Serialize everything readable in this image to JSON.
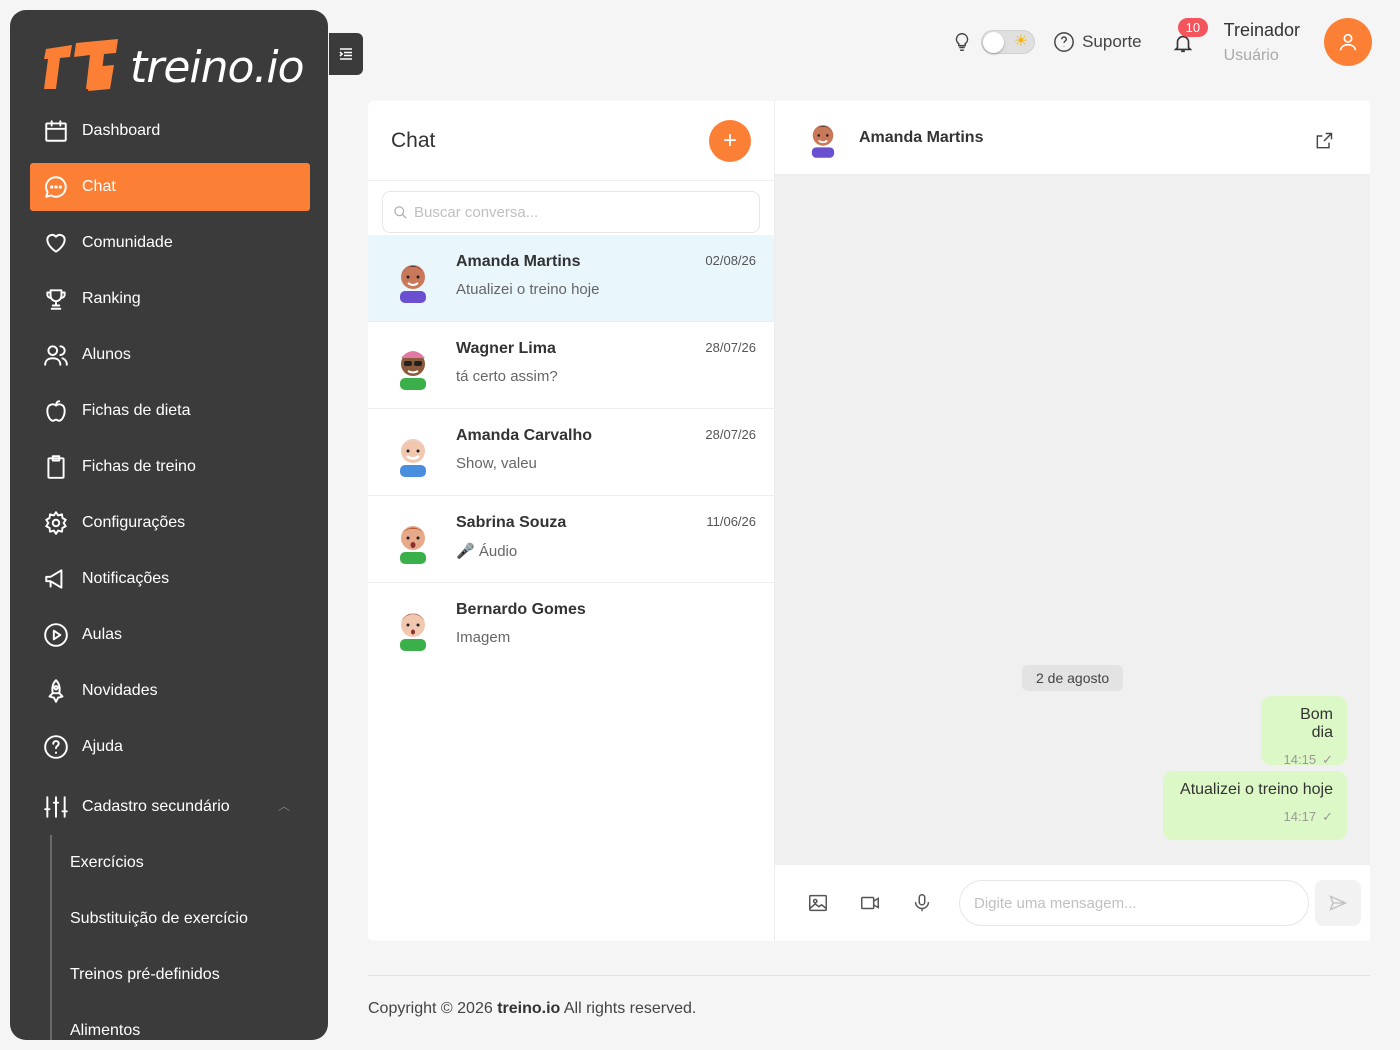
{
  "app": {
    "logo_text": "treino.io"
  },
  "sidebar": {
    "items": [
      {
        "label": "Dashboard",
        "icon": "calendar-icon"
      },
      {
        "label": "Chat",
        "icon": "chat-icon",
        "active": true
      },
      {
        "label": "Comunidade",
        "icon": "heart-icon"
      },
      {
        "label": "Ranking",
        "icon": "trophy-icon"
      },
      {
        "label": "Alunos",
        "icon": "users-icon"
      },
      {
        "label": "Fichas de dieta",
        "icon": "apple-icon"
      },
      {
        "label": "Fichas de treino",
        "icon": "clipboard-icon"
      },
      {
        "label": "Configurações",
        "icon": "gear-icon"
      },
      {
        "label": "Notificações",
        "icon": "megaphone-icon"
      },
      {
        "label": "Aulas",
        "icon": "play-icon"
      },
      {
        "label": "Novidades",
        "icon": "rocket-icon"
      },
      {
        "label": "Ajuda",
        "icon": "help-icon"
      }
    ],
    "secondary": {
      "label": "Cadastro secundário",
      "icon": "sliders-icon",
      "items": [
        "Exercícios",
        "Substituição de exercício",
        "Treinos pré-definidos",
        "Alimentos"
      ]
    }
  },
  "topbar": {
    "support_label": "Suporte",
    "notification_count": "10",
    "user_name": "Treinador",
    "user_role": "Usuário"
  },
  "chat": {
    "title": "Chat",
    "search_placeholder": "Buscar conversa...",
    "conversations": [
      {
        "name": "Amanda Martins",
        "preview": "Atualizei o treino hoje",
        "date": "02/08/26",
        "active": true
      },
      {
        "name": "Wagner Lima",
        "preview": "tá certo assim?",
        "date": "28/07/26"
      },
      {
        "name": "Amanda Carvalho",
        "preview": "Show, valeu",
        "date": "28/07/26"
      },
      {
        "name": "Sabrina Souza",
        "preview": "🎤 Áudio",
        "date": "11/06/26"
      },
      {
        "name": "Bernardo Gomes",
        "preview": "Imagem",
        "date": ""
      }
    ],
    "active_contact": "Amanda Martins",
    "date_chip": "2 de agosto",
    "messages": [
      {
        "text": "Bom dia",
        "time": "14:15"
      },
      {
        "text": "Atualizei o treino hoje",
        "time": "14:17"
      }
    ],
    "message_placeholder": "Digite uma mensagem..."
  },
  "footer": {
    "prefix": "Copyright © 2026 ",
    "brand": "treino.io",
    "suffix": " All rights reserved."
  },
  "colors": {
    "accent": "#fb8035",
    "sidebar_bg": "#3b3b3b",
    "bubble_bg": "#dcf8c6",
    "active_row": "#e9f6fc",
    "badge": "#f4545b"
  }
}
